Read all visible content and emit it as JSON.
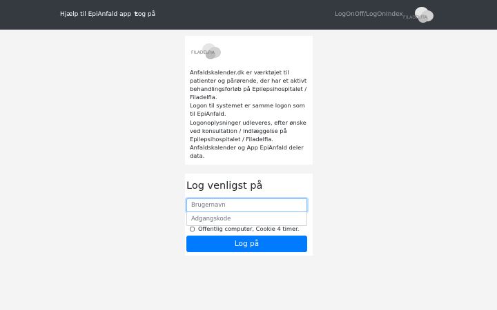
{
  "navbar": {
    "help_menu_label": "Hjælp til EpiAnfald app",
    "login_link": "Log på",
    "logon_links": "LogOnOff/LogOnIndex",
    "logo_text": "FILADELFIA",
    "icon": "chevron-down-icon"
  },
  "info": {
    "logo_text": "FILADELFIA",
    "lines": [
      "Anfaldskalender.dk er værktøjet til patienter og pårørende, der har et aktivt behandlingsforløb på Epilepsihospitalet / Filadelfia.",
      "Logon til systemet er samme logon som til EpiAnfald.",
      "Logonoplysninger udleveres, efter ønske ved konsultation / indlæggelse på Epilepsihospitalet / Filadelfia.",
      "Anfaldskalender og App EpiAnfald deler data."
    ]
  },
  "login": {
    "title": "Log venligst på",
    "username_placeholder": "Brugernavn",
    "username_value": "",
    "password_placeholder": "Adgangskode",
    "password_value": "",
    "remember_label": "Offentlig computer, Cookie 4 timer.",
    "remember_checked": false,
    "submit_label": "Log på"
  },
  "colors": {
    "navbar_bg": "#343a40",
    "primary": "#007bff",
    "page_bg": "#f4f4f4"
  }
}
